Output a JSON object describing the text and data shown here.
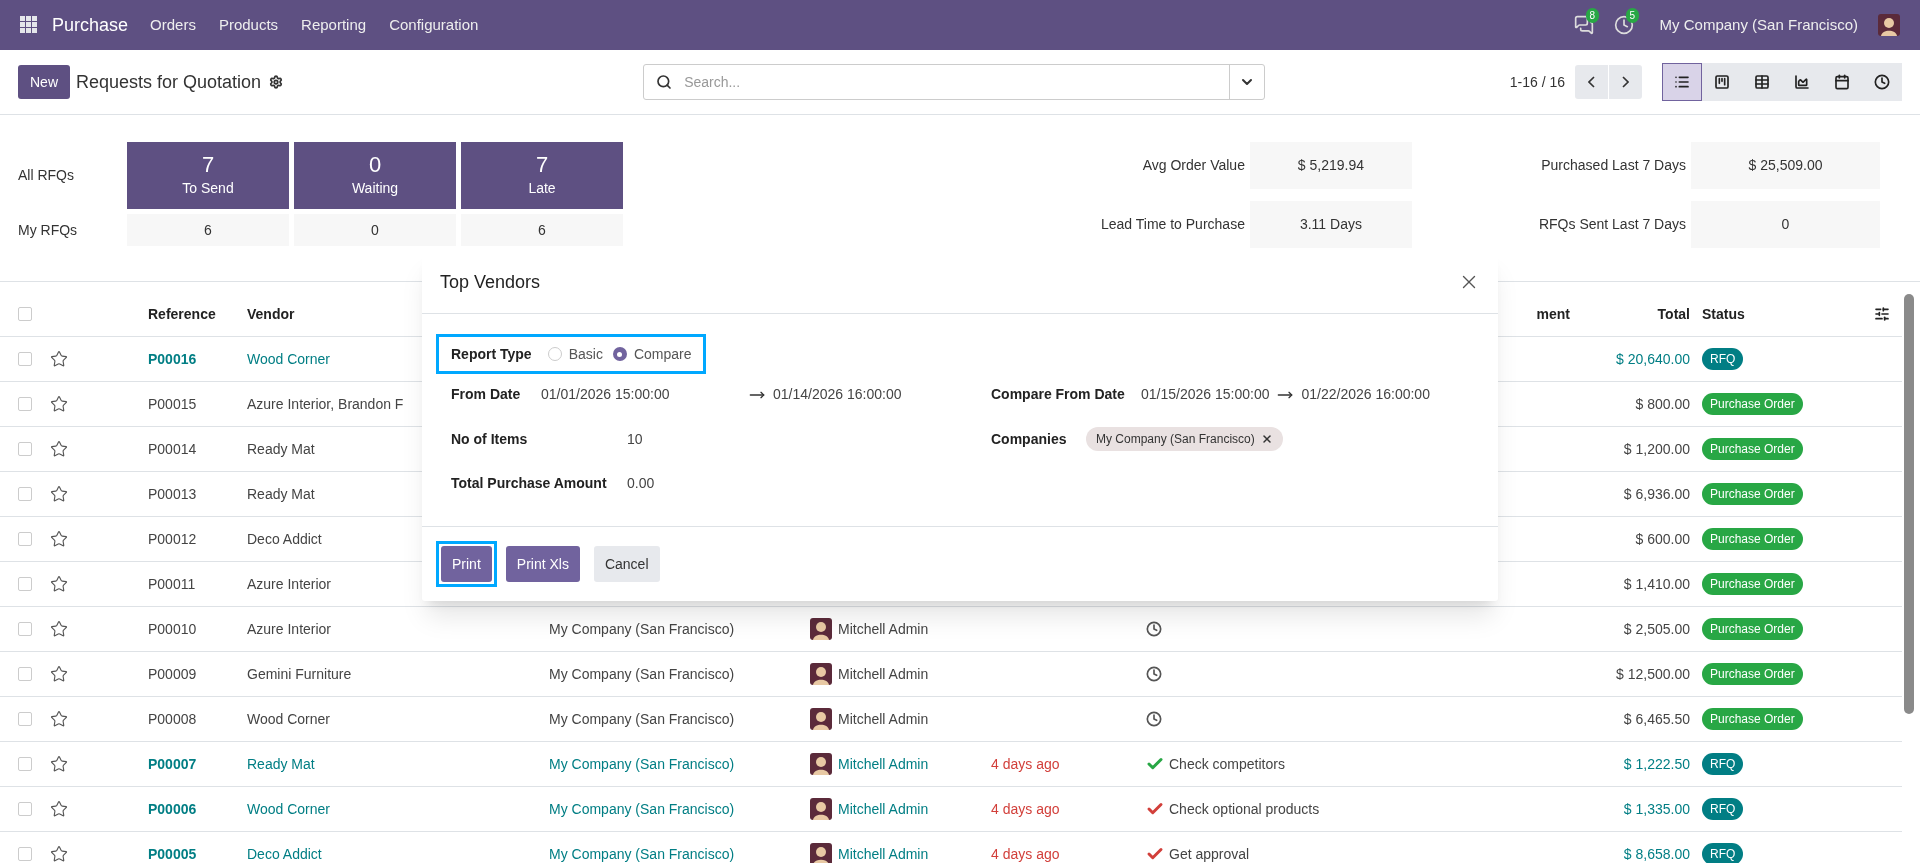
{
  "navbar": {
    "app": "Purchase",
    "menu": [
      "Orders",
      "Products",
      "Reporting",
      "Configuration"
    ],
    "messages_count": "8",
    "activities_count": "5",
    "company": "My Company (San Francisco)"
  },
  "control_panel": {
    "new_button": "New",
    "title": "Requests for Quotation",
    "search": {
      "placeholder": "Search..."
    },
    "pager": "1-16 / 16",
    "views": [
      {
        "kind": "list",
        "selected": true
      },
      {
        "kind": "kanban",
        "selected": false
      },
      {
        "kind": "pivot",
        "selected": false
      },
      {
        "kind": "graph",
        "selected": false
      },
      {
        "kind": "calendar",
        "selected": false
      },
      {
        "kind": "activity",
        "selected": false
      }
    ]
  },
  "dashboard": {
    "rows": [
      {
        "label": "All RFQs",
        "cells": [
          {
            "value": "7",
            "label": "To Send"
          },
          {
            "value": "0",
            "label": "Waiting"
          },
          {
            "value": "7",
            "label": "Late"
          }
        ]
      },
      {
        "label": "My RFQs",
        "cells": [
          {
            "value": "6"
          },
          {
            "value": "0"
          },
          {
            "value": "6"
          }
        ]
      }
    ],
    "stats": [
      {
        "label": "Avg Order Value",
        "value": "$ 5,219.94"
      },
      {
        "label": "Purchased Last 7 Days",
        "value": "$ 25,509.00"
      },
      {
        "label": "Lead Time to Purchase",
        "value": "3.11 Days"
      },
      {
        "label": "RFQs Sent Last 7 Days",
        "value": "0"
      }
    ]
  },
  "table": {
    "all_selected": false,
    "columns": {
      "reference": "Reference",
      "vendor": "Vendor",
      "activity": "ment",
      "total": "Total",
      "status": "Status"
    },
    "rows": [
      {
        "selected": false,
        "starred": false,
        "reference": "P00016",
        "vendor": "Wood Corner",
        "total": "$ 20,640.00",
        "status": {
          "label": "RFQ",
          "kind": "rfq"
        }
      },
      {
        "selected": false,
        "starred": false,
        "reference": "P00015",
        "vendor": "Azure Interior, Brandon F",
        "total": "$ 800.00",
        "status": {
          "label": "Purchase Order",
          "kind": "order"
        }
      },
      {
        "selected": false,
        "starred": false,
        "reference": "P00014",
        "vendor": "Ready Mat",
        "total": "$ 1,200.00",
        "status": {
          "label": "Purchase Order",
          "kind": "order"
        }
      },
      {
        "selected": false,
        "starred": false,
        "reference": "P00013",
        "vendor": "Ready Mat",
        "total": "$ 6,936.00",
        "status": {
          "label": "Purchase Order",
          "kind": "order"
        }
      },
      {
        "selected": false,
        "starred": false,
        "reference": "P00012",
        "vendor": "Deco Addict",
        "total": "$ 600.00",
        "status": {
          "label": "Purchase Order",
          "kind": "order"
        }
      },
      {
        "selected": false,
        "starred": false,
        "reference": "P00011",
        "vendor": "Azure Interior",
        "total": "$ 1,410.00",
        "status": {
          "label": "Purchase Order",
          "kind": "order"
        }
      },
      {
        "selected": false,
        "starred": false,
        "reference": "P00010",
        "vendor": "Azure Interior",
        "company": "My Company (San Francisco)",
        "buyer": "Mitchell Admin",
        "activity": {
          "kind": "clock"
        },
        "total": "$ 2,505.00",
        "status": {
          "label": "Purchase Order",
          "kind": "order"
        }
      },
      {
        "selected": false,
        "starred": false,
        "reference": "P00009",
        "vendor": "Gemini Furniture",
        "company": "My Company (San Francisco)",
        "buyer": "Mitchell Admin",
        "activity": {
          "kind": "clock"
        },
        "total": "$ 12,500.00",
        "status": {
          "label": "Purchase Order",
          "kind": "order"
        }
      },
      {
        "selected": false,
        "starred": false,
        "reference": "P00008",
        "vendor": "Wood Corner",
        "company": "My Company (San Francisco)",
        "buyer": "Mitchell Admin",
        "activity": {
          "kind": "clock"
        },
        "total": "$ 6,465.50",
        "status": {
          "label": "Purchase Order",
          "kind": "order"
        }
      },
      {
        "selected": false,
        "starred": false,
        "reference": "P00007",
        "vendor": "Ready Mat",
        "company": "My Company (San Francisco)",
        "buyer": "Mitchell Admin",
        "deadline": "4 days ago",
        "activity": {
          "kind": "planned",
          "text": "Check competitors"
        },
        "total": "$ 1,222.50",
        "status": {
          "label": "RFQ",
          "kind": "rfq"
        }
      },
      {
        "selected": false,
        "starred": false,
        "reference": "P00006",
        "vendor": "Wood Corner",
        "company": "My Company (San Francisco)",
        "buyer": "Mitchell Admin",
        "deadline": "4 days ago",
        "activity": {
          "kind": "overdue",
          "text": "Check optional products"
        },
        "total": "$ 1,335.00",
        "status": {
          "label": "RFQ",
          "kind": "rfq"
        }
      },
      {
        "selected": false,
        "starred": false,
        "reference": "P00005",
        "vendor": "Deco Addict",
        "company": "My Company (San Francisco)",
        "buyer": "Mitchell Admin",
        "deadline": "4 days ago",
        "activity": {
          "kind": "overdue",
          "text": "Get approval"
        },
        "total": "$ 8,658.00",
        "status": {
          "label": "RFQ",
          "kind": "rfq"
        }
      }
    ]
  },
  "dialog": {
    "title": "Top Vendors",
    "report_type": {
      "label": "Report Type",
      "highlighted": true,
      "options": [
        {
          "label": "Basic",
          "selected": false
        },
        {
          "label": "Compare",
          "selected": true
        }
      ]
    },
    "from_date": {
      "label": "From Date",
      "start": "01/01/2026 15:00:00",
      "end": "01/14/2026 16:00:00"
    },
    "compare_from_date": {
      "label": "Compare From Date",
      "start": "01/15/2026 15:00:00",
      "end": "01/22/2026 16:00:00"
    },
    "no_of_items": {
      "label": "No of Items",
      "value": "10"
    },
    "companies": {
      "label": "Companies",
      "tags": [
        "My Company (San Francisco)"
      ]
    },
    "total_purchase_amount": {
      "label": "Total Purchase Amount",
      "value": "0.00"
    },
    "buttons": [
      {
        "label": "Print",
        "kind": "primary",
        "highlighted": true
      },
      {
        "label": "Print Xls",
        "kind": "primary",
        "highlighted": false
      },
      {
        "label": "Cancel",
        "kind": "secondary",
        "highlighted": false
      }
    ]
  }
}
